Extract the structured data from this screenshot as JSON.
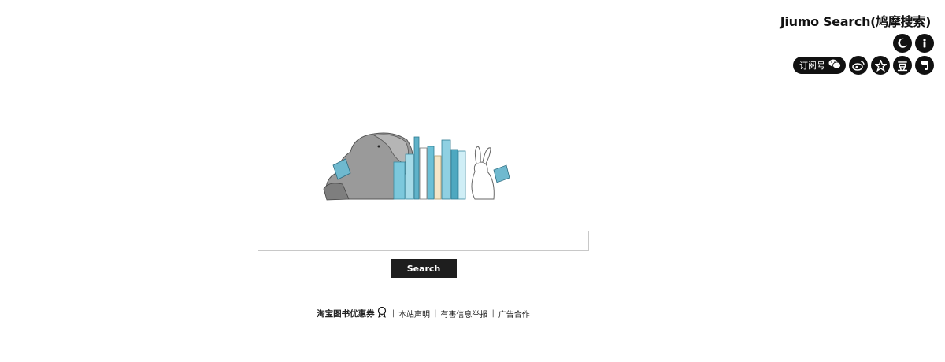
{
  "header": {
    "title": "Jiumo Search(鸠摩搜索)",
    "icons": {
      "theme": "moon-icon",
      "info": "info-icon"
    },
    "social": {
      "wechat_label": "订阅号",
      "wechat_icon": "wechat-icon",
      "weibo_icon": "weibo-icon",
      "star_icon": "star-icon",
      "douban_label": "豆",
      "evernote_icon": "evernote-icon"
    }
  },
  "search": {
    "value": "",
    "placeholder": "",
    "button_label": "Search"
  },
  "footer": {
    "promo": "淘宝图书优惠券",
    "promo_icon": "gift-icon",
    "links": [
      "本站声明",
      "有害信息举报",
      "广告合作"
    ],
    "separator": "|"
  },
  "colors": {
    "dark": "#111111",
    "book_blue": "#7cc8dc",
    "book_cream": "#f5e6c8"
  }
}
